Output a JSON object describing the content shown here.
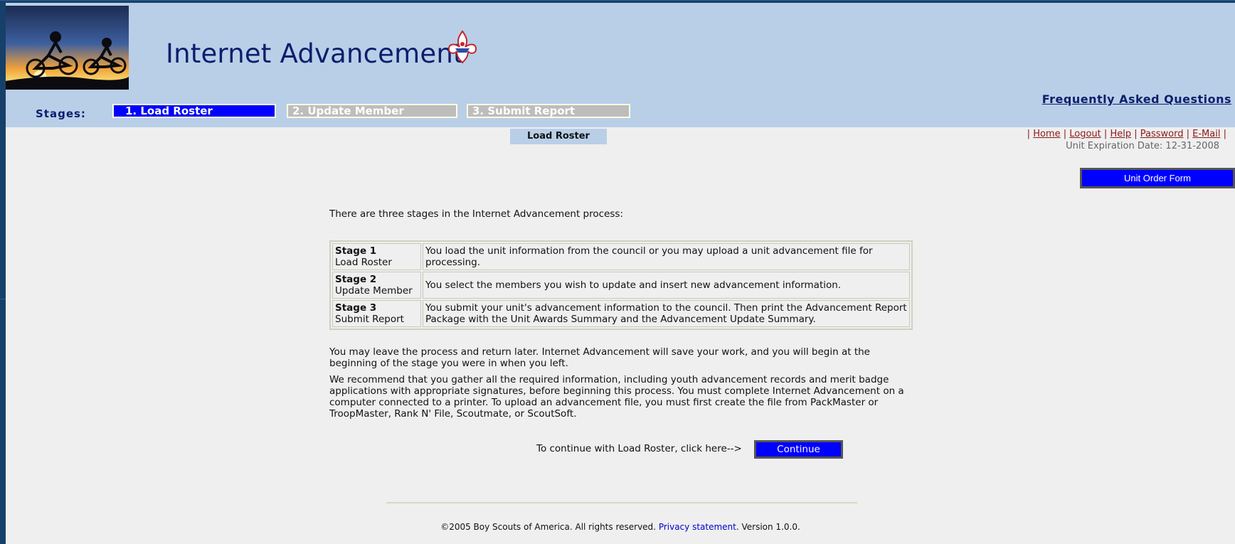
{
  "app": {
    "title": "Internet Advancement"
  },
  "header": {
    "faq_link": "Frequently Asked Questions",
    "stages_label": "Stages:",
    "stages": [
      {
        "label": "1. Load Roster",
        "state": "active"
      },
      {
        "label": "2. Update Member",
        "state": "inactive"
      },
      {
        "label": "3. Submit Report",
        "state": "inactive"
      }
    ]
  },
  "current_tab": "Load Roster",
  "top_links": {
    "sep": "|",
    "home": "Home",
    "logout": "Logout",
    "help": "Help",
    "password": "Password",
    "email": "E-Mail",
    "expiration": "Unit Expiration Date: 12-31-2008"
  },
  "unit_order_button": "Unit Order Form",
  "main": {
    "intro": "There are three stages in the Internet Advancement process:",
    "stage_rows": [
      {
        "title": "Stage 1",
        "name": "Load Roster",
        "desc": "You load the unit information from the council or you may upload a unit advancement file for processing."
      },
      {
        "title": "Stage 2",
        "name": "Update Member",
        "desc": "You select the members you wish to update and insert new advancement information."
      },
      {
        "title": "Stage 3",
        "name": "Submit Report",
        "desc": "You submit your unit's advancement information to the council. Then print the Advancement Report Package with the Unit Awards Summary and the Advancement Update Summary."
      }
    ],
    "paragraph1": "You may leave the process and return later. Internet Advancement will save your work, and you will begin at the beginning of the stage you were in when you left.",
    "paragraph2": "We recommend that you gather all the required information, including youth advancement records and merit badge applications with appropriate signatures, before beginning this process. You must complete Internet Advancement on a computer connected to a printer. To upload an advancement file, you must first create the file from PackMaster or TroopMaster, Rank N' File, Scoutmate, or ScoutSoft.",
    "continue_prompt": "To continue with Load Roster, click here-->",
    "continue_button": "Continue"
  },
  "footer": {
    "copyright": "©2005 Boy Scouts of America. All rights reserved.",
    "privacy": "Privacy statement",
    "version": ". Version 1.0.0."
  },
  "colors": {
    "header_bg": "#b9cfe8",
    "active_stage": "#0000ff",
    "inactive_stage": "#bdbdbd",
    "title_navy": "#0c1e6c",
    "link_red": "#8b1a1a",
    "outer_bg": "#16406a"
  },
  "icons": {
    "logo": "bsa-fleur-de-lis-icon",
    "photo": "cyclists-sunset-photo"
  }
}
